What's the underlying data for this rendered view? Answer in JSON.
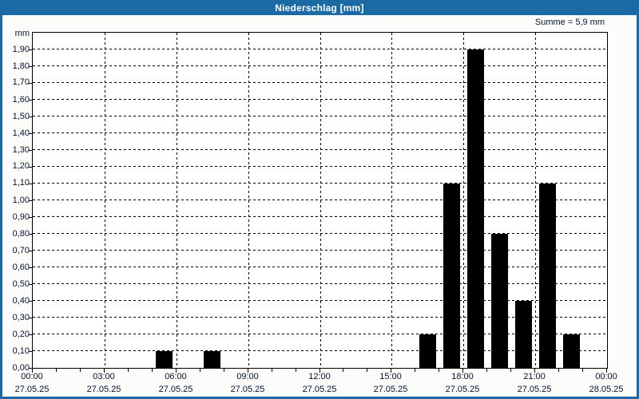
{
  "window": {
    "title": "Niederschlag [mm]"
  },
  "colors": {
    "titlebar": "#1b6aa5",
    "window_border": "#1b6aa5",
    "title_text": "#ffffff",
    "label_text": "#031433",
    "axis": "#000000",
    "bar": "#000000",
    "plot_background": "#ffffff",
    "window_background": "#fcfdfa"
  },
  "chart_data": {
    "type": "bar",
    "title": "Niederschlag [mm]",
    "ylabel": "mm",
    "xlabel": "",
    "sum_label": "Summe = 5,9 mm",
    "sum_mm": 5.9,
    "ylim": [
      0,
      2.0
    ],
    "y_tick_step": 0.1,
    "y_tick_labels": [
      "0,00",
      "0,10",
      "0,20",
      "0,30",
      "0,40",
      "0,50",
      "0,60",
      "0,70",
      "0,80",
      "0,90",
      "1,00",
      "1,10",
      "1,20",
      "1,30",
      "1,40",
      "1,50",
      "1,60",
      "1,70",
      "1,80",
      "1,90"
    ],
    "x_range_hours": [
      0,
      24
    ],
    "x_minor_tick_every_hours": 1,
    "x_major_tick_every_hours": 3,
    "x_major_ticks": [
      {
        "time": "00:00",
        "date": "27.05.25"
      },
      {
        "time": "03:00",
        "date": "27.05.25"
      },
      {
        "time": "06:00",
        "date": "27.05.25"
      },
      {
        "time": "09:00",
        "date": "27.05.25"
      },
      {
        "time": "12:00",
        "date": "27.05.25"
      },
      {
        "time": "15:00",
        "date": "27.05.25"
      },
      {
        "time": "18:00",
        "date": "27.05.25"
      },
      {
        "time": "21:00",
        "date": "27.05.25"
      },
      {
        "time": "00:00",
        "date": "28.05.25"
      }
    ],
    "grid": true,
    "grid_style": "dashed",
    "legend": false,
    "series": [
      {
        "name": "Niederschlag",
        "unit": "mm",
        "hour_start": 0,
        "hourly_values_mm": [
          0,
          0,
          0,
          0,
          0,
          0.1,
          0,
          0.1,
          0,
          0,
          0,
          0,
          0,
          0,
          0,
          0,
          0.2,
          1.1,
          1.9,
          0.8,
          0.4,
          1.1,
          0.2,
          0
        ]
      }
    ]
  }
}
